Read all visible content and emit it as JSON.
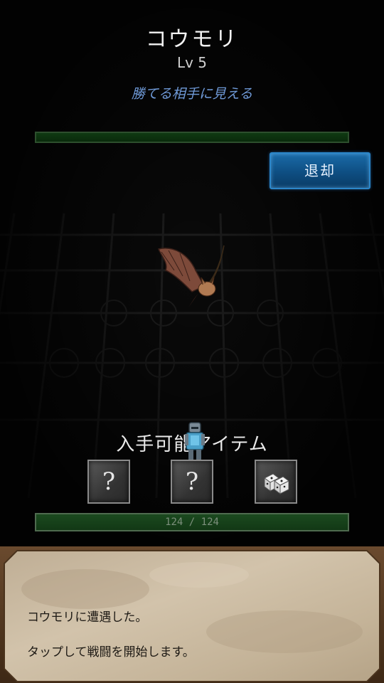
{
  "enemy": {
    "name": "コウモリ",
    "level": "Lv 5",
    "hint": "勝てる相手に見える",
    "hp_fraction": 1.0
  },
  "retreat_label": "退却",
  "items": {
    "title": "入手可能アイテム",
    "slots": [
      {
        "glyph": "?",
        "icon": "unknown-item-icon"
      },
      {
        "glyph": "?",
        "icon": "unknown-item-icon"
      },
      {
        "glyph": "",
        "icon": "dice-icon"
      }
    ]
  },
  "player": {
    "hp_text": "124 / 124",
    "hp_fraction": 1.0
  },
  "messages": [
    "コウモリに遭遇した。",
    "タップして戦闘を開始します。"
  ],
  "colors": {
    "hint": "#6f9ad8",
    "button": "#1a6ba8",
    "hp_green": "#123815",
    "parchment": "#c9b9a0"
  }
}
